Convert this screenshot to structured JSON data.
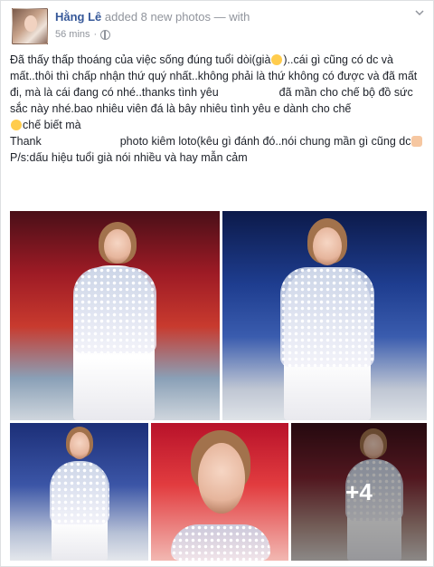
{
  "post": {
    "author": "Hằng Lê",
    "action": " added 8 new photos — with",
    "time": "56 mins",
    "separator": "·",
    "text_lines": [
      "Đã thấy thấp thoáng của việc sống đúng tuổi dòi(già",
      ")..cái gì cũng có dc và mất..thôi thì chấp nhận thứ quý nhất..không phải là thứ không có được và đã mất đi, mà là cái đang có nhé..thanks tình yêu",
      "đã mần cho chế bộ đồ sức sắc này nhé.bao nhiêu viên đá là bây nhiêu tình yêu e dành cho chế",
      "chế biết mà",
      "Thank",
      "photo kiêm loto(kêu gì đánh đó..nói chung mần gì cũng dc",
      "P/s:dấu hiệu tuổi già nói nhiều và hay mẫn cảm"
    ]
  },
  "photos": {
    "more_count": "+4"
  },
  "icons": {
    "audience": "globe-icon",
    "options": "chevron-down-icon",
    "emoji_laugh": "laughing-emoji-icon",
    "emoji_wink": "winking-emoji-icon",
    "emoji_hand": "pointing-hand-emoji-icon"
  },
  "colors": {
    "author_link": "#365899",
    "meta_text": "#90949c",
    "body_text": "#1d2129"
  }
}
